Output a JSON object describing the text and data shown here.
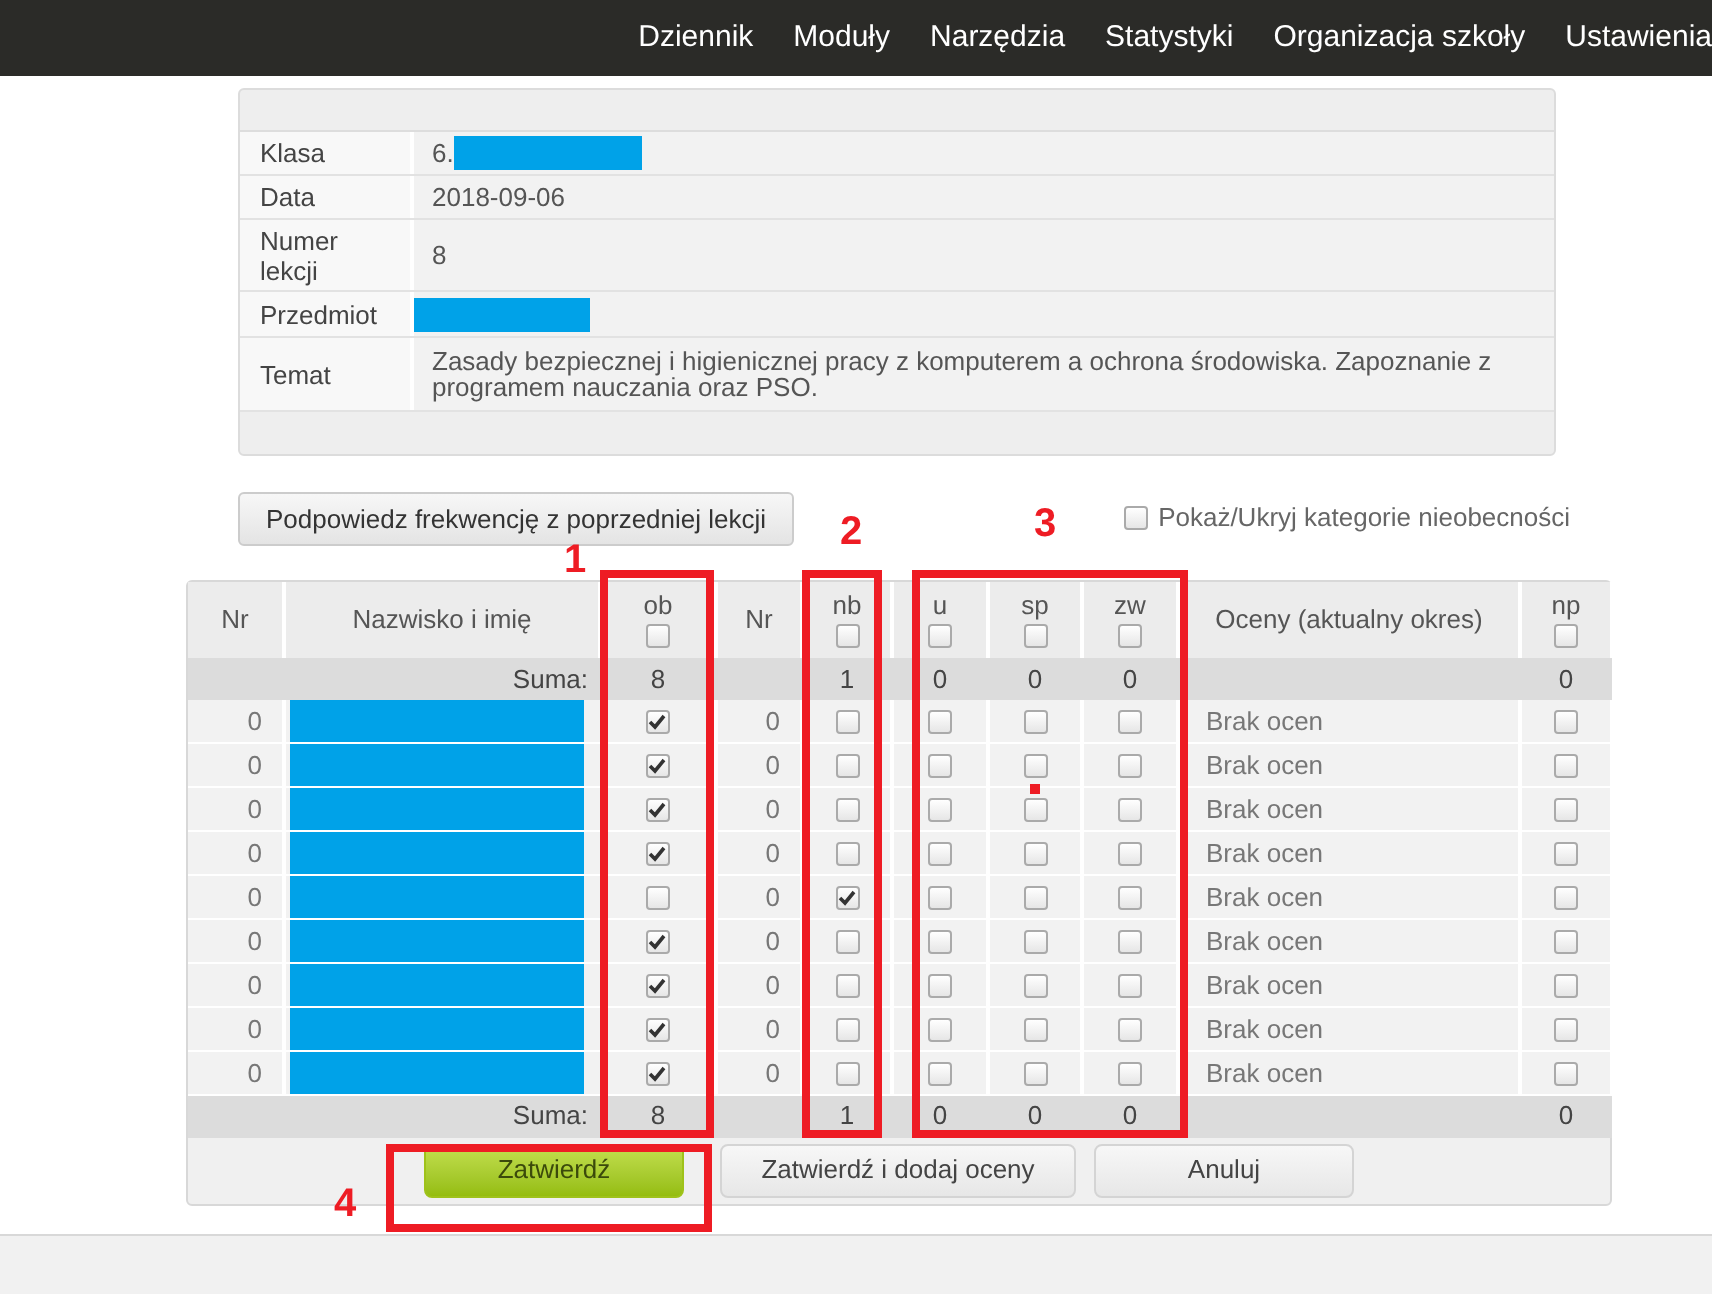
{
  "nav": {
    "items": [
      "Dziennik",
      "Moduły",
      "Narzędzia",
      "Statystyki",
      "Organizacja szkoły",
      "Ustawienia"
    ]
  },
  "lesson_info": [
    {
      "label": "Klasa",
      "value": "6.",
      "redacted": true
    },
    {
      "label": "Data",
      "value": "2018-09-06",
      "redacted": false
    },
    {
      "label": "Numer lekcji",
      "value": "8",
      "redacted": false
    },
    {
      "label": "Przedmiot",
      "redacted": true
    },
    {
      "label": "Temat",
      "value": "Zasady bezpiecznej i higienicznej pracy z komputerem a ochrona środowiska. Zapoznanie z programem nauczania oraz PSO.",
      "redacted": false
    }
  ],
  "suggest_button": "Podpowiedz frekwencję z poprzedniej lekcji",
  "toggle_categories": {
    "label": "Pokaż/Ukryj kategorie nieobecności",
    "checked": false
  },
  "table": {
    "columns": [
      "Nr",
      "Nazwisko i imię",
      "ob",
      "Nr",
      "nb",
      "u",
      "sp",
      "zw",
      "Oceny (aktualny okres)",
      "np"
    ],
    "header_checks": {
      "ob": false,
      "nb": false,
      "u": false,
      "sp": false,
      "zw": false,
      "np": false
    },
    "sum_top": {
      "label": "Suma:",
      "ob": "8",
      "nb": "1",
      "u": "0",
      "sp": "0",
      "zw": "0",
      "np": "0"
    },
    "rows": [
      {
        "nr": "0",
        "name_redacted": true,
        "ob": true,
        "nr2": "0",
        "nb": false,
        "u": false,
        "sp": false,
        "zw": false,
        "grades": "Brak ocen",
        "np": false
      },
      {
        "nr": "0",
        "name_redacted": true,
        "ob": true,
        "nr2": "0",
        "nb": false,
        "u": false,
        "sp": false,
        "zw": false,
        "grades": "Brak ocen",
        "np": false
      },
      {
        "nr": "0",
        "name_redacted": true,
        "ob": true,
        "nr2": "0",
        "nb": false,
        "u": false,
        "sp": false,
        "zw": false,
        "grades": "Brak ocen",
        "np": false
      },
      {
        "nr": "0",
        "name_redacted": true,
        "ob": true,
        "nr2": "0",
        "nb": false,
        "u": false,
        "sp": false,
        "zw": false,
        "grades": "Brak ocen",
        "np": false
      },
      {
        "nr": "0",
        "name_redacted": true,
        "ob": false,
        "nr2": "0",
        "nb": true,
        "u": false,
        "sp": false,
        "zw": false,
        "grades": "Brak ocen",
        "np": false
      },
      {
        "nr": "0",
        "name_redacted": true,
        "ob": true,
        "nr2": "0",
        "nb": false,
        "u": false,
        "sp": false,
        "zw": false,
        "grades": "Brak ocen",
        "np": false
      },
      {
        "nr": "0",
        "name_redacted": true,
        "ob": true,
        "nr2": "0",
        "nb": false,
        "u": false,
        "sp": false,
        "zw": false,
        "grades": "Brak ocen",
        "np": false
      },
      {
        "nr": "0",
        "name_redacted": true,
        "ob": true,
        "nr2": "0",
        "nb": false,
        "u": false,
        "sp": false,
        "zw": false,
        "grades": "Brak ocen",
        "np": false
      },
      {
        "nr": "0",
        "name_redacted": true,
        "ob": true,
        "nr2": "0",
        "nb": false,
        "u": false,
        "sp": false,
        "zw": false,
        "grades": "Brak ocen",
        "np": false
      }
    ],
    "sum_bottom": {
      "label": "Suma:",
      "ob": "8",
      "nb": "1",
      "u": "0",
      "sp": "0",
      "zw": "0",
      "np": "0"
    }
  },
  "buttons": [
    {
      "label": "Zatwierdź",
      "kind": "primary"
    },
    {
      "label": "Zatwierdź i dodaj oceny",
      "kind": "secondary"
    },
    {
      "label": "Anuluj",
      "kind": "secondary"
    }
  ],
  "annotations": [
    {
      "kind": "box"
    },
    {
      "kind": "box"
    },
    {
      "kind": "box"
    },
    {
      "kind": "box"
    },
    {
      "kind": "label",
      "text": "1"
    },
    {
      "kind": "label",
      "text": "2"
    },
    {
      "kind": "label",
      "text": "3"
    },
    {
      "kind": "label",
      "text": "4"
    },
    {
      "kind": "dot"
    }
  ]
}
